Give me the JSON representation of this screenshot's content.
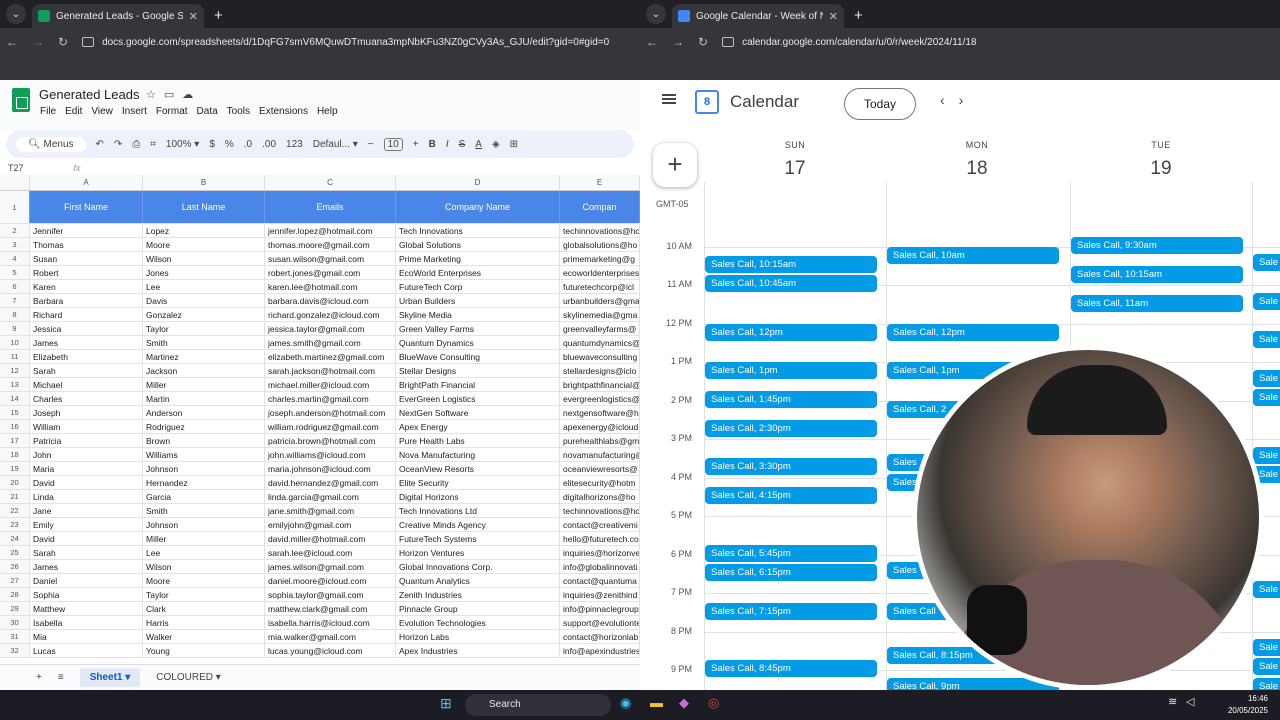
{
  "left_browser": {
    "tab_title": "Generated Leads - Google Shee",
    "url": "docs.google.com/spreadsheets/d/1DqFG7smV6MQuwDTmuana3mpNbKFu3NZ0gCVy3As_GJU/edit?gid=0#gid=0"
  },
  "sheets": {
    "doc_title": "Generated Leads",
    "menu": [
      "File",
      "Edit",
      "View",
      "Insert",
      "Format",
      "Data",
      "Tools",
      "Extensions",
      "Help"
    ],
    "toolbar": {
      "menus": "Menus",
      "zoom": "100%",
      "currency": "$",
      "percent": "%",
      "dec_dec": ".0",
      "dec_inc": ".00",
      "num_fmt": "123",
      "font": "Defaul...",
      "font_size": "10"
    },
    "cell_ref": "T27",
    "columns": [
      "A",
      "B",
      "C",
      "D",
      "E"
    ],
    "headers": [
      "First Name",
      "Last Name",
      "Emails",
      "Company Name",
      "Compan"
    ],
    "rows": [
      [
        "2",
        "Jennifer",
        "Lopez",
        "jennifer.lopez@hotmail.com",
        "Tech Innovations",
        "techinnovations@ho"
      ],
      [
        "3",
        "Thomas",
        "Moore",
        "thomas.moore@gmail.com",
        "Global Solutions",
        "globalsolutions@ho"
      ],
      [
        "4",
        "Susan",
        "Wilson",
        "susan.wilson@gmail.com",
        "Prime Marketing",
        "primemarketing@g"
      ],
      [
        "5",
        "Robert",
        "Jones",
        "robert.jones@gmail.com",
        "EcoWorld Enterprises",
        "ecoworldenterprises"
      ],
      [
        "6",
        "Karen",
        "Lee",
        "karen.lee@hotmail.com",
        "FutureTech Corp",
        "futuretechcorp@icl"
      ],
      [
        "7",
        "Barbara",
        "Davis",
        "barbara.davis@icloud.com",
        "Urban Builders",
        "urbanbuilders@gma"
      ],
      [
        "8",
        "Richard",
        "Gonzalez",
        "richard.gonzalez@icloud.com",
        "Skyline Media",
        "skylinemedia@gma"
      ],
      [
        "9",
        "Jessica",
        "Taylor",
        "jessica.taylor@gmail.com",
        "Green Valley Farms",
        "greenvalleyfarms@"
      ],
      [
        "10",
        "James",
        "Smith",
        "james.smith@gmail.com",
        "Quantum Dynamics",
        "quantumdynamics@"
      ],
      [
        "11",
        "Elizabeth",
        "Martinez",
        "elizabeth.martinez@gmail.com",
        "BlueWave Consulting",
        "bluewaveconsulting"
      ],
      [
        "12",
        "Sarah",
        "Jackson",
        "sarah.jackson@hotmail.com",
        "Stellar Designs",
        "stellardesigns@iclo"
      ],
      [
        "13",
        "Michael",
        "Miller",
        "michael.miller@icloud.com",
        "BrightPath Financial",
        "brightpathfinancial@"
      ],
      [
        "14",
        "Charles",
        "Martin",
        "charles.martin@gmail.com",
        "EverGreen Logistics",
        "evergreenlogistics@"
      ],
      [
        "15",
        "Joseph",
        "Anderson",
        "joseph.anderson@hotmail.com",
        "NextGen Software",
        "nextgensoftware@h"
      ],
      [
        "16",
        "William",
        "Rodriguez",
        "william.rodriguez@gmail.com",
        "Apex Energy",
        "apexenergy@icloud"
      ],
      [
        "17",
        "Patricia",
        "Brown",
        "patricia.brown@hotmail.com",
        "Pure Health Labs",
        "purehealthlabs@gm"
      ],
      [
        "18",
        "John",
        "Williams",
        "john.williams@icloud.com",
        "Nova Manufacturing",
        "novamanufacturing@"
      ],
      [
        "19",
        "Maria",
        "Johnson",
        "maria.johnson@icloud.com",
        "OceanView Resorts",
        "oceanviewresorts@"
      ],
      [
        "20",
        "David",
        "Hernandez",
        "david.hernandez@gmail.com",
        "Elite Security",
        "elitesecurity@hotm"
      ],
      [
        "21",
        "Linda",
        "Garcia",
        "linda.garcia@gmail.com",
        "Digital Horizons",
        "digitalhorizons@ho"
      ],
      [
        "22",
        "Jane",
        "Smith",
        "jane.smith@gmail.com",
        "Tech Innovations Ltd",
        "techinnovations@ho"
      ],
      [
        "23",
        "Emily",
        "Johnson",
        "emilyjohn@gmail.com",
        "Creative Minds Agency",
        "contact@creativemi"
      ],
      [
        "24",
        "David",
        "Miller",
        "david.miller@hotmail.com",
        "FutureTech Systems",
        "hello@futuretech.co"
      ],
      [
        "25",
        "Sarah",
        "Lee",
        "sarah.lee@icloud.com",
        "Horizon Ventures",
        "inquiries@horizonve"
      ],
      [
        "26",
        "James",
        "Wilson",
        "james.wilson@gmail.com",
        "Global Innovations Corp.",
        "info@globalinnovati"
      ],
      [
        "27",
        "Daniel",
        "Moore",
        "daniel.moore@icloud.com",
        "Quantum Analytics",
        "contact@quantuma"
      ],
      [
        "28",
        "Sophia",
        "Taylor",
        "sophia.taylor@gmail.com",
        "Zenith Industries",
        "inquiries@zenithind"
      ],
      [
        "29",
        "Matthew",
        "Clark",
        "matthew.clark@gmail.com",
        "Pinnacle Group",
        "info@pinnaclegroup"
      ],
      [
        "30",
        "Isabella",
        "Harris",
        "isabella.harris@icloud.com",
        "Evolution Technologies",
        "support@evolutionte"
      ],
      [
        "31",
        "Mia",
        "Walker",
        "mia.walker@gmail.com",
        "Horizon Labs",
        "contact@horizonlab"
      ],
      [
        "32",
        "Lucas",
        "Young",
        "lucas.young@icloud.com",
        "Apex Industries",
        "info@apexindustries"
      ]
    ],
    "sheet_tabs": [
      "Sheet1",
      "COLOURED"
    ]
  },
  "right_browser": {
    "tab_title": "Google Calendar - Week of No",
    "url": "calendar.google.com/calendar/u/0/r/week/2024/11/18"
  },
  "calendar": {
    "app_name": "Calendar",
    "logo_day": "8",
    "today_label": "Today",
    "timezone": "GMT-05",
    "days": [
      {
        "name": "SUN",
        "date": "17"
      },
      {
        "name": "MON",
        "date": "18"
      },
      {
        "name": "TUE",
        "date": "19"
      }
    ],
    "hours": [
      "10 AM",
      "11 AM",
      "12 PM",
      "1 PM",
      "2 PM",
      "3 PM",
      "4 PM",
      "5 PM",
      "6 PM",
      "7 PM",
      "8 PM",
      "9 PM"
    ],
    "events": [
      {
        "day": 0,
        "label": "Sales Call, 10:15am",
        "start": 10.25
      },
      {
        "day": 0,
        "label": "Sales Call, 10:45am",
        "start": 10.75
      },
      {
        "day": 0,
        "label": "Sales Call, 12pm",
        "start": 12.0
      },
      {
        "day": 0,
        "label": "Sales Call, 1pm",
        "start": 13.0
      },
      {
        "day": 0,
        "label": "Sales Call, 1:45pm",
        "start": 13.75
      },
      {
        "day": 0,
        "label": "Sales Call, 2:30pm",
        "start": 14.5
      },
      {
        "day": 0,
        "label": "Sales Call, 3:30pm",
        "start": 15.5
      },
      {
        "day": 0,
        "label": "Sales Call, 4:15pm",
        "start": 16.25
      },
      {
        "day": 0,
        "label": "Sales Call, 5:45pm",
        "start": 17.75
      },
      {
        "day": 0,
        "label": "Sales Call, 6:15pm",
        "start": 18.25
      },
      {
        "day": 0,
        "label": "Sales Call, 7:15pm",
        "start": 19.25
      },
      {
        "day": 0,
        "label": "Sales Call, 8:45pm",
        "start": 20.75
      },
      {
        "day": 1,
        "label": "Sales Call, 10am",
        "start": 10.0
      },
      {
        "day": 1,
        "label": "Sales Call, 12pm",
        "start": 12.0
      },
      {
        "day": 1,
        "label": "Sales Call, 1pm",
        "start": 13.0
      },
      {
        "day": 1,
        "label": "Sales Call, 2",
        "start": 14.0
      },
      {
        "day": 1,
        "label": "Sales",
        "start": 15.4
      },
      {
        "day": 1,
        "label": "Sales",
        "start": 15.9
      },
      {
        "day": 1,
        "label": "Sales",
        "start": 18.2
      },
      {
        "day": 1,
        "label": "Sales Call",
        "start": 19.25
      },
      {
        "day": 1,
        "label": "Sales Call, 8:15pm",
        "start": 20.4
      },
      {
        "day": 1,
        "label": "Sales Call, 9pm",
        "start": 21.2
      },
      {
        "day": 2,
        "label": "Sales Call, 9:30am",
        "start": 9.75
      },
      {
        "day": 2,
        "label": "Sales Call, 10:15am",
        "start": 10.5
      },
      {
        "day": 2,
        "label": "Sales Call, 11am",
        "start": 11.25
      },
      {
        "day": 3,
        "label": "Sale",
        "start": 10.2
      },
      {
        "day": 3,
        "label": "Sale",
        "start": 11.2
      },
      {
        "day": 3,
        "label": "Sale",
        "start": 12.2
      },
      {
        "day": 3,
        "label": "Sale",
        "start": 13.2
      },
      {
        "day": 3,
        "label": "Sale",
        "start": 13.7
      },
      {
        "day": 3,
        "label": "Sale",
        "start": 15.2
      },
      {
        "day": 3,
        "label": "Sale",
        "start": 15.7
      },
      {
        "day": 3,
        "label": "Sale",
        "start": 18.7
      },
      {
        "day": 3,
        "label": "Sale",
        "start": 20.2
      },
      {
        "day": 3,
        "label": "Sale",
        "start": 20.7
      },
      {
        "day": 3,
        "label": "Sale",
        "start": 21.2
      }
    ]
  },
  "taskbar": {
    "search_label": "Search",
    "time": "16:46",
    "date": "20/05/2025"
  },
  "colors": {
    "event": "#039be5",
    "header": "#4a86e8",
    "sheets_green": "#0f9d58"
  }
}
